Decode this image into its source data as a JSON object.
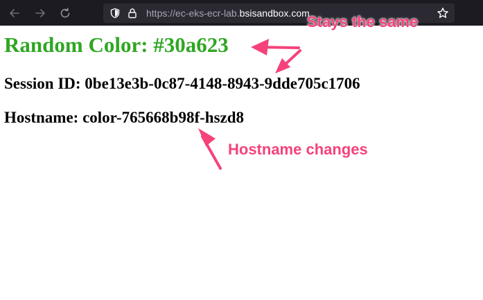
{
  "browser": {
    "url_prefix": "https://ec-eks-ecr-lab.",
    "url_host": "bsisandbox.com"
  },
  "page": {
    "title": "Random Color: #30a623",
    "title_color": "#30a623",
    "session": "Session ID: 0be13e3b-0c87-4148-8943-9dde705c1706",
    "hostname": "Hostname: color-765668b98f-hszd8"
  },
  "annotations": {
    "stays": "Stays the same",
    "changes": "Hostname changes",
    "color": "#f5427a"
  },
  "icons": [
    "back-arrow-icon",
    "forward-arrow-icon",
    "reload-icon",
    "shield-icon",
    "lock-icon",
    "bookmark-star-icon"
  ]
}
